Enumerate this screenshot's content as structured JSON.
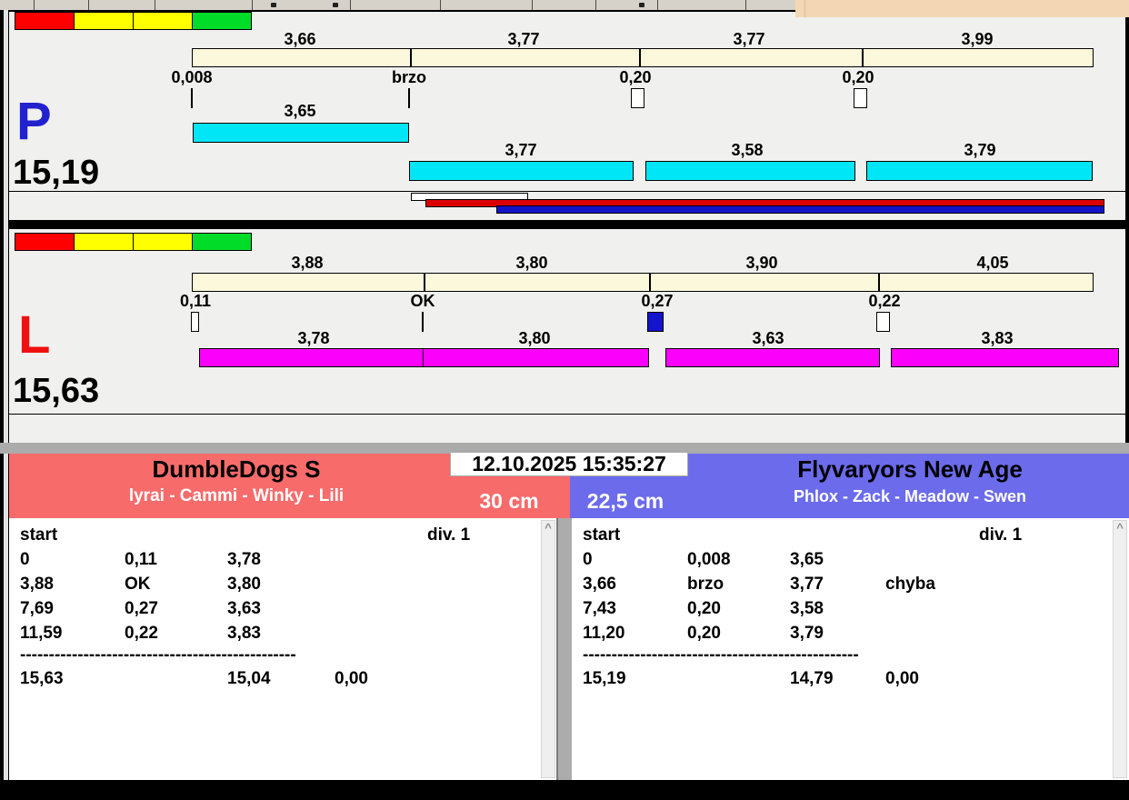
{
  "window": {
    "clock": "12.10.2025 15:35:27"
  },
  "icons": {
    "scroll_up": "^"
  },
  "misc": {
    "leg_bar_color": "#FBF8DC",
    "overall_white_bar": "#FFFFFF",
    "overall_red_bar": "#DB0000",
    "overall_blue_bar": "#1313C8"
  },
  "lanes": [
    {
      "letter": "P",
      "letter_color": "#2121D0",
      "total_time": "15,19",
      "bar_color": "#00E6F6",
      "status_lights": [
        "#FF0000",
        "#FFFF00",
        "#FFFF00",
        "#00DC28"
      ],
      "leg_times": [
        "3,66",
        "3,77",
        "3,77",
        "3,99"
      ],
      "cross_labels": [
        "0,008",
        "brzo",
        "0,20",
        "0,20"
      ],
      "cross_marker_types": [
        "tick",
        "tick",
        "box-white",
        "box-white"
      ],
      "dog_run_times": [
        "3,65",
        "3,77",
        "3,58",
        "3,79"
      ]
    },
    {
      "letter": "L",
      "letter_color": "#F01010",
      "total_time": "15,63",
      "bar_color": "#FB00FB",
      "status_lights": [
        "#FF0000",
        "#FFFF00",
        "#FFFF00",
        "#00DC28"
      ],
      "leg_times": [
        "3,88",
        "3,80",
        "3,90",
        "4,05"
      ],
      "cross_labels": [
        "0,11",
        "OK",
        "0,27",
        "0,22"
      ],
      "cross_marker_types": [
        "box-white",
        "tick",
        "box-blue",
        "box-white"
      ],
      "dog_run_times": [
        "3,78",
        "3,80",
        "3,63",
        "3,83"
      ]
    }
  ],
  "teams": [
    {
      "name": "DumbleDogs S",
      "dogs": "lyrai - Cammi - Winky - Lili",
      "jump_height": "30 cm",
      "accent_color": "#F76B6B",
      "table": {
        "start_label": "start",
        "division_label": "div. 1",
        "rows": [
          [
            "0",
            "0,11",
            "3,78",
            ""
          ],
          [
            "3,88",
            "OK",
            "3,80",
            ""
          ],
          [
            "7,69",
            "0,27",
            "3,63",
            ""
          ],
          [
            "11,59",
            "0,22",
            "3,83",
            ""
          ]
        ],
        "separator": "------------------------------------------------",
        "totals": {
          "run_time": "15,63",
          "clean_time": "15,04",
          "penalty": "0,00"
        }
      }
    },
    {
      "name": "Flyvaryors New Age",
      "dogs": "Phlox - Zack - Meadow - Swen",
      "jump_height": "22,5 cm",
      "accent_color": "#6B6BEB",
      "table": {
        "start_label": "start",
        "division_label": "div. 1",
        "rows": [
          [
            "0",
            "0,008",
            "3,65",
            ""
          ],
          [
            "3,66",
            "brzo",
            "3,77",
            "chyba"
          ],
          [
            "7,43",
            "0,20",
            "3,58",
            ""
          ],
          [
            "11,20",
            "0,20",
            "3,79",
            ""
          ]
        ],
        "separator": "------------------------------------------------",
        "totals": {
          "run_time": "15,19",
          "clean_time": "14,79",
          "penalty": "0,00"
        }
      }
    }
  ]
}
